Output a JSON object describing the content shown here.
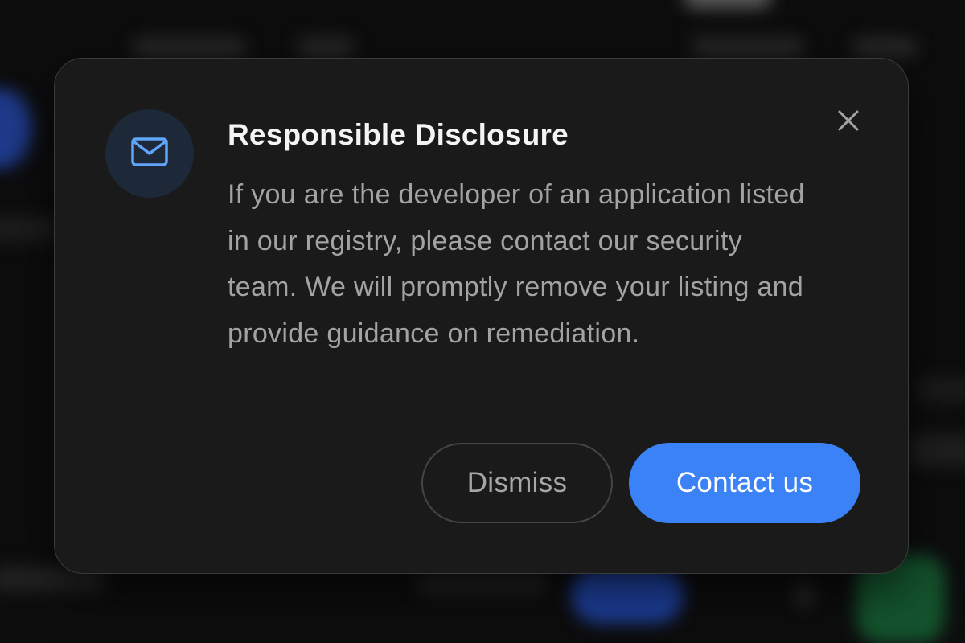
{
  "dialog": {
    "title": "Responsible Disclosure",
    "message": "If you are the developer of an application listed in our registry, please contact our security team. We will promptly remove your listing and provide guidance on remediation.",
    "dismiss_label": "Dismiss",
    "contact_label": "Contact us",
    "header_icon": "mail-icon",
    "close_icon": "close-icon"
  },
  "colors": {
    "accent": "#3b82f6",
    "dialog_bg": "#1a1a1a",
    "icon_bg": "#1d2838",
    "icon_color": "#60a5fa"
  }
}
